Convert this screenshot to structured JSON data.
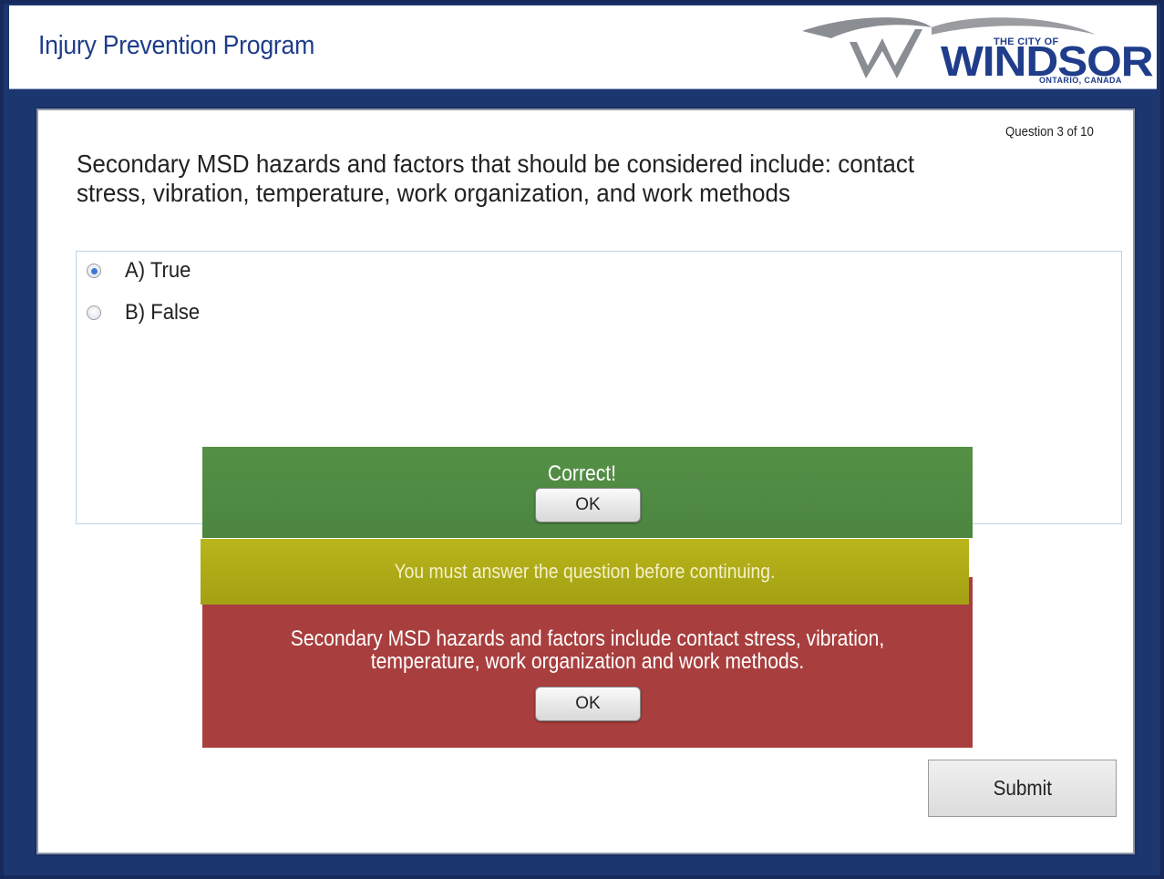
{
  "header": {
    "title": "Injury Prevention Program",
    "logo": {
      "top_text": "THE CITY OF",
      "main_text": "WINDSOR",
      "sub_text": "ONTARIO, CANADA"
    }
  },
  "quiz": {
    "counter": "Question 3 of 10",
    "question": "Secondary MSD hazards and factors that should be considered include: contact stress, vibration, temperature, work organization, and work methods",
    "options": [
      {
        "label": "A) True",
        "selected": true
      },
      {
        "label": "B) False",
        "selected": false
      }
    ],
    "submit_label": "Submit"
  },
  "feedback": {
    "correct": {
      "title": "Correct!",
      "ok_label": "OK",
      "color": "#559046"
    },
    "warning": {
      "text": "You must answer the question before continuing.",
      "color": "#b9b51a"
    },
    "incorrect": {
      "text": "Secondary MSD hazards and factors include contact stress, vibration, temperature, work organization and work methods.",
      "ok_label": "OK",
      "color": "#a83e3e"
    }
  },
  "colors": {
    "background": "#1c3670",
    "title": "#1f3d8a"
  }
}
